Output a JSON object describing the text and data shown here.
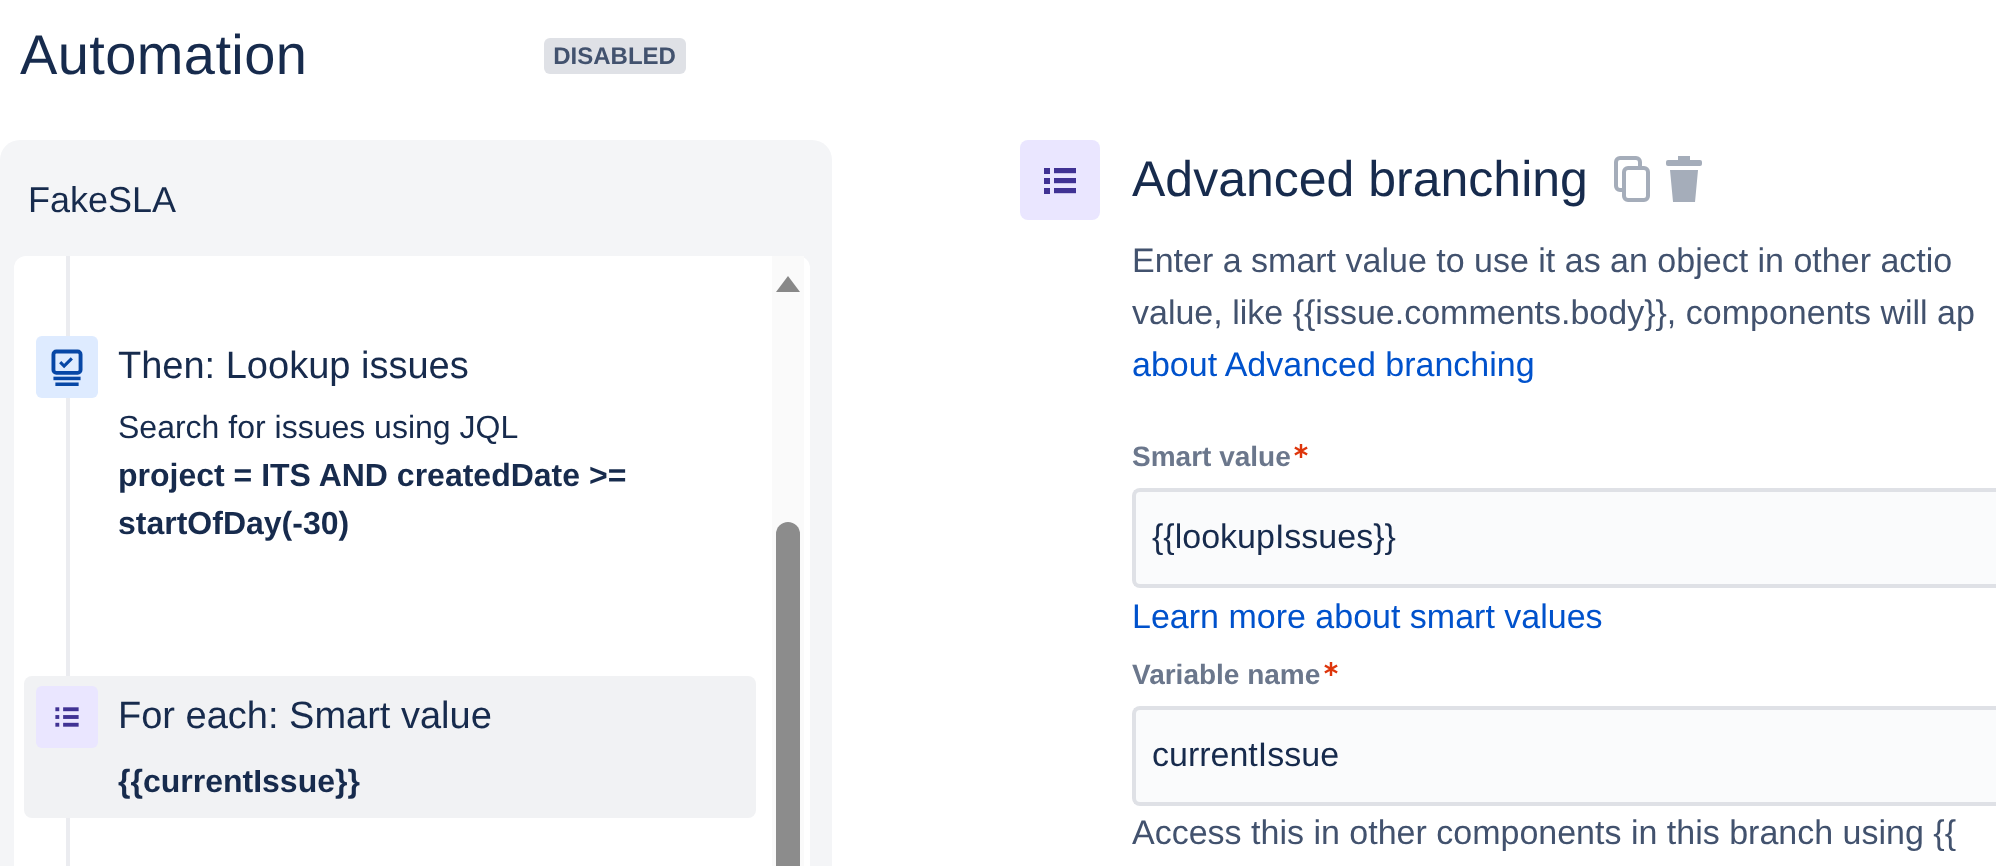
{
  "header": {
    "title": "Automation",
    "status_badge": "DISABLED"
  },
  "rule_panel": {
    "title": "FakeSLA",
    "steps": [
      {
        "kind": "action",
        "title": "Then: Lookup issues",
        "description": "Search for issues using JQL",
        "detail": "project = ITS AND createdDate >= startOfDay(-30)",
        "selected": false
      },
      {
        "kind": "branch",
        "title": "For each: Smart value",
        "detail": "{{currentIssue}}",
        "selected": true
      }
    ]
  },
  "details": {
    "title": "Advanced branching",
    "description_lines": [
      "Enter a smart value to use it as an object in other actio",
      "value, like {{issue.comments.body}}, components will ap"
    ],
    "description_link": "about Advanced branching",
    "fields": [
      {
        "label": "Smart value",
        "required": true,
        "value": "{{lookupIssues}}",
        "help_link": "Learn more about smart values"
      },
      {
        "label": "Variable name",
        "required": true,
        "value": "currentIssue",
        "help_text": "Access this in other components in this branch using {{"
      }
    ]
  }
}
